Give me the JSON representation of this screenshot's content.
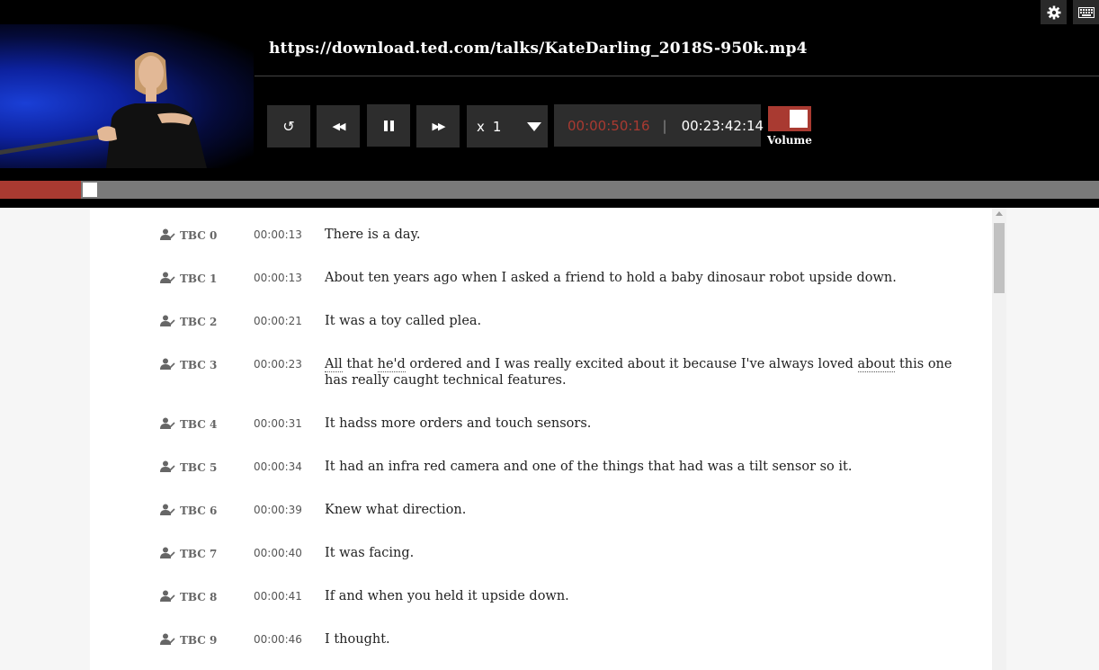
{
  "player": {
    "url": "https://download.ted.com/talks/KateDarling_2018S-950k.mp4",
    "speed_prefix": "x",
    "speed_value": "1",
    "current_time": "00:00:50:16",
    "time_divider": "|",
    "total_time": "00:23:42:14",
    "volume_label": "Volume",
    "progress_fraction": 0.074,
    "accent_color": "#a93a31",
    "icons": {
      "settings": "gear-icon",
      "keyboard": "keyboard-icon",
      "replay": "replay-icon",
      "rewind": "rewind-icon",
      "pause": "pause-icon",
      "forward": "fast-forward-icon",
      "dropdown": "chevron-down-icon",
      "speaker": "speaker-edit-icon"
    }
  },
  "transcript": [
    {
      "speaker": "TBC 0",
      "time": "00:00:13",
      "text": "There is a day."
    },
    {
      "speaker": "TBC 1",
      "time": "00:00:13",
      "text": "About ten years ago when I asked a friend to hold a baby dinosaur robot upside down."
    },
    {
      "speaker": "TBC 2",
      "time": "00:00:21",
      "text": "It was a toy called plea."
    },
    {
      "speaker": "TBC 3",
      "time": "00:00:23",
      "w1": "All",
      "t1": " that ",
      "w2": "he'd",
      "t2": " ordered and I was really excited about it because I've always loved ",
      "w3": "about",
      "t3": " this one has really caught technical features."
    },
    {
      "speaker": "TBC 4",
      "time": "00:00:31",
      "text": "It hadss more orders and touch sensors."
    },
    {
      "speaker": "TBC 5",
      "time": "00:00:34",
      "text": "It had an infra red camera and one of the things that had was a tilt sensor so it."
    },
    {
      "speaker": "TBC 6",
      "time": "00:00:39",
      "text": "Knew what direction."
    },
    {
      "speaker": "TBC 7",
      "time": "00:00:40",
      "text": "It was facing."
    },
    {
      "speaker": "TBC 8",
      "time": "00:00:41",
      "text": "If and when you held it upside down."
    },
    {
      "speaker": "TBC 9",
      "time": "00:00:46",
      "text": "I thought."
    }
  ]
}
